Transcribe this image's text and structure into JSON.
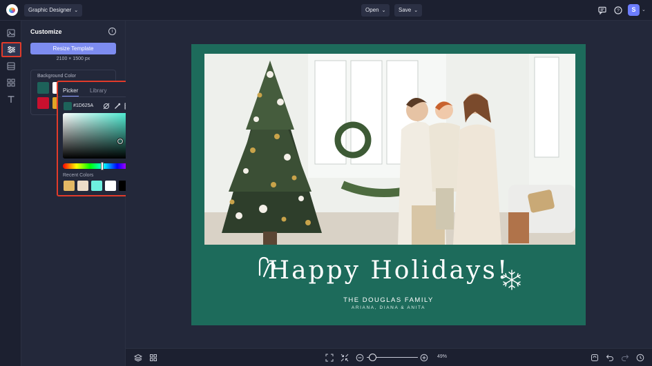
{
  "app": {
    "switcher_label": "Graphic Designer"
  },
  "toolbar": {
    "open_label": "Open",
    "save_label": "Save",
    "user_initial": "S"
  },
  "panel": {
    "title": "Customize",
    "resize_button": "Resize Template",
    "dimensions": "2100 × 1500 px",
    "background_color_label": "Background Color",
    "swatches": [
      "#1d625a",
      "#ffffff",
      "#c8102e",
      "#e0a526"
    ]
  },
  "picker": {
    "tab_picker": "Picker",
    "tab_library": "Library",
    "hex_value": "#1D625A",
    "recent_label": "Recent Colors",
    "recent_colors": [
      "#e3b965",
      "#ecdcc8",
      "#6ef0e0",
      "#ffffff",
      "#000000",
      "#1d625a"
    ],
    "hue_fraction": 0.5
  },
  "card": {
    "background_color": "#1d6b5b",
    "title": "Happy Holidays!",
    "subtitle": "THE DOUGLAS FAMILY",
    "names": "ARIANA, DIANA & ANITA"
  },
  "footer": {
    "zoom": "49%"
  },
  "icons": [
    "logo",
    "chevron-down-icon",
    "comment-icon",
    "help-icon",
    "image-icon",
    "sliders-icon",
    "layout-icon",
    "grid-icon",
    "text-icon",
    "info-icon",
    "layers-icon",
    "fit-screen-icon",
    "shrink-icon",
    "zoom-out-icon",
    "zoom-in-icon",
    "refresh-icon",
    "undo-icon",
    "redo-icon",
    "history-icon"
  ]
}
